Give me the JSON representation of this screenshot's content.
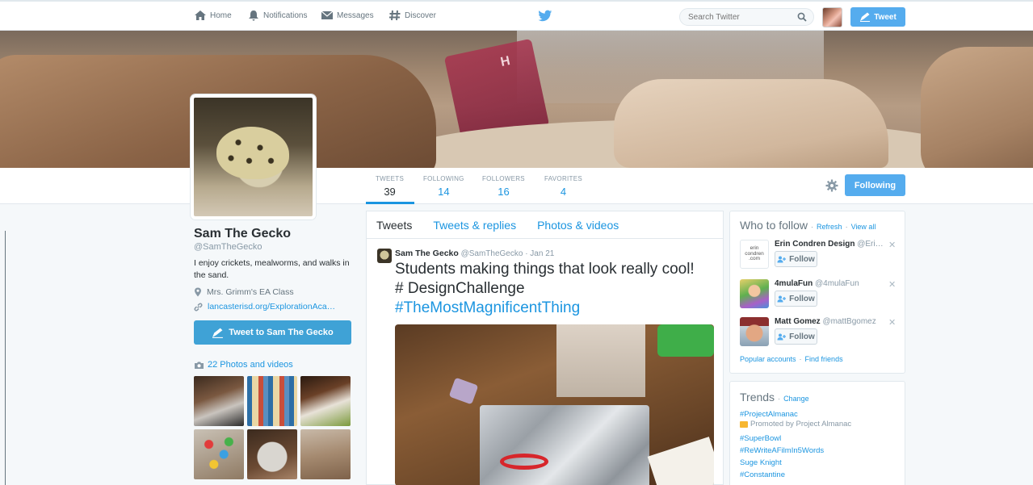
{
  "nav": {
    "home": "Home",
    "notifications": "Notifications",
    "messages": "Messages",
    "discover": "Discover",
    "search_placeholder": "Search Twitter",
    "tweet_button": "Tweet"
  },
  "banner": {
    "flag_letter": "H"
  },
  "stats": [
    {
      "label": "TWEETS",
      "value": "39"
    },
    {
      "label": "FOLLOWING",
      "value": "14"
    },
    {
      "label": "FOLLOWERS",
      "value": "16"
    },
    {
      "label": "FAVORITES",
      "value": "4"
    }
  ],
  "following_button": "Following",
  "profile": {
    "name": "Sam The Gecko",
    "handle": "@SamTheGecko",
    "bio": "I enjoy crickets, mealworms, and walks in the sand.",
    "location": "Mrs. Grimm's EA Class",
    "link": "lancasterisd.org/ExplorationAca…",
    "tweet_to_button": "Tweet to Sam The Gecko",
    "photos_label": "22 Photos and videos"
  },
  "timeline": {
    "tabs": [
      "Tweets",
      "Tweets & replies",
      "Photos & videos"
    ],
    "tweet": {
      "name": "Sam The Gecko",
      "handle": "@SamTheGecko",
      "time": "· Jan 21",
      "text_line1": "Students making things that look really cool!",
      "text_line2": "# DesignChallenge",
      "hashtag": "#TheMostMagnificentThing"
    }
  },
  "who_to_follow": {
    "title": "Who to follow",
    "refresh": "Refresh",
    "view_all": "View all",
    "sep": "·",
    "items": [
      {
        "name": "Erin Condren Design",
        "handle": "@Eri…",
        "follow": "Follow",
        "avatar_text": "erin condren .com"
      },
      {
        "name": "4mulaFun",
        "handle": "@4mulaFun",
        "follow": "Follow"
      },
      {
        "name": "Matt Gomez",
        "handle": "@mattBgomez",
        "follow": "Follow"
      }
    ],
    "popular": "Popular accounts",
    "find_friends": "Find friends"
  },
  "trends": {
    "title": "Trends",
    "change": "Change",
    "items": [
      "#ProjectAlmanac",
      "#SuperBowl",
      "#ReWriteAFilmIn5Words",
      "Suge Knight",
      "#Constantine"
    ],
    "promoted": "Promoted by Project Almanac"
  },
  "colors": {
    "accent": "#55acee",
    "link": "#1b95e0"
  }
}
